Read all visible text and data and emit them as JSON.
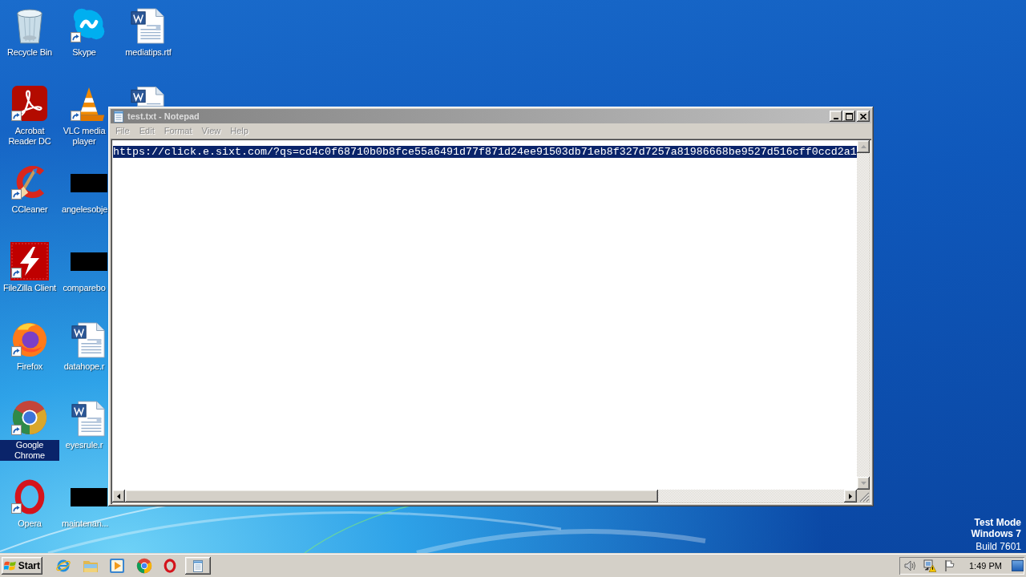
{
  "desktop": {
    "columns": [
      {
        "items": [
          {
            "label": "Recycle Bin",
            "shortcut": false,
            "selected": false
          },
          {
            "label": "Acrobat Reader DC",
            "shortcut": true,
            "selected": false
          },
          {
            "label": "CCleaner",
            "shortcut": true,
            "selected": false
          },
          {
            "label": "FileZilla Client",
            "shortcut": true,
            "selected": false
          },
          {
            "label": "Firefox",
            "shortcut": true,
            "selected": false
          },
          {
            "label": "Google Chrome",
            "shortcut": true,
            "selected": true
          },
          {
            "label": "Opera",
            "shortcut": true,
            "selected": false
          }
        ]
      },
      {
        "items": [
          {
            "label": "Skype",
            "shortcut": true,
            "selected": false
          },
          {
            "label": "VLC media player",
            "shortcut": true,
            "selected": false
          },
          {
            "label": "angelesobje",
            "shortcut": false,
            "selected": false
          },
          {
            "label": "comparebo",
            "shortcut": false,
            "selected": false
          },
          {
            "label": "datahope.r",
            "shortcut": false,
            "selected": false
          },
          {
            "label": "eyesrule.r",
            "shortcut": false,
            "selected": false
          },
          {
            "label": "maintenan...",
            "shortcut": false,
            "selected": false
          }
        ]
      },
      {
        "items": [
          {
            "label": "mediatips.rtf",
            "shortcut": false,
            "selected": false
          },
          {
            "shortcut": false
          }
        ]
      }
    ],
    "os_notice": [
      "Test Mode",
      "Windows 7",
      "Build 7601"
    ]
  },
  "notepad": {
    "title": "test.txt - Notepad",
    "active": false,
    "menu": [
      "File",
      "Edit",
      "Format",
      "View",
      "Help"
    ],
    "text": "https://click.e.sixt.com/?qs=cd4c0f68710b0b8fce55a6491d77f871d24ee91503db71eb8f327d7257a81986668be9527d516cff0ccd2a1",
    "text_selected": true
  },
  "taskbar": {
    "start": "Start",
    "clock": "1:49 PM"
  }
}
